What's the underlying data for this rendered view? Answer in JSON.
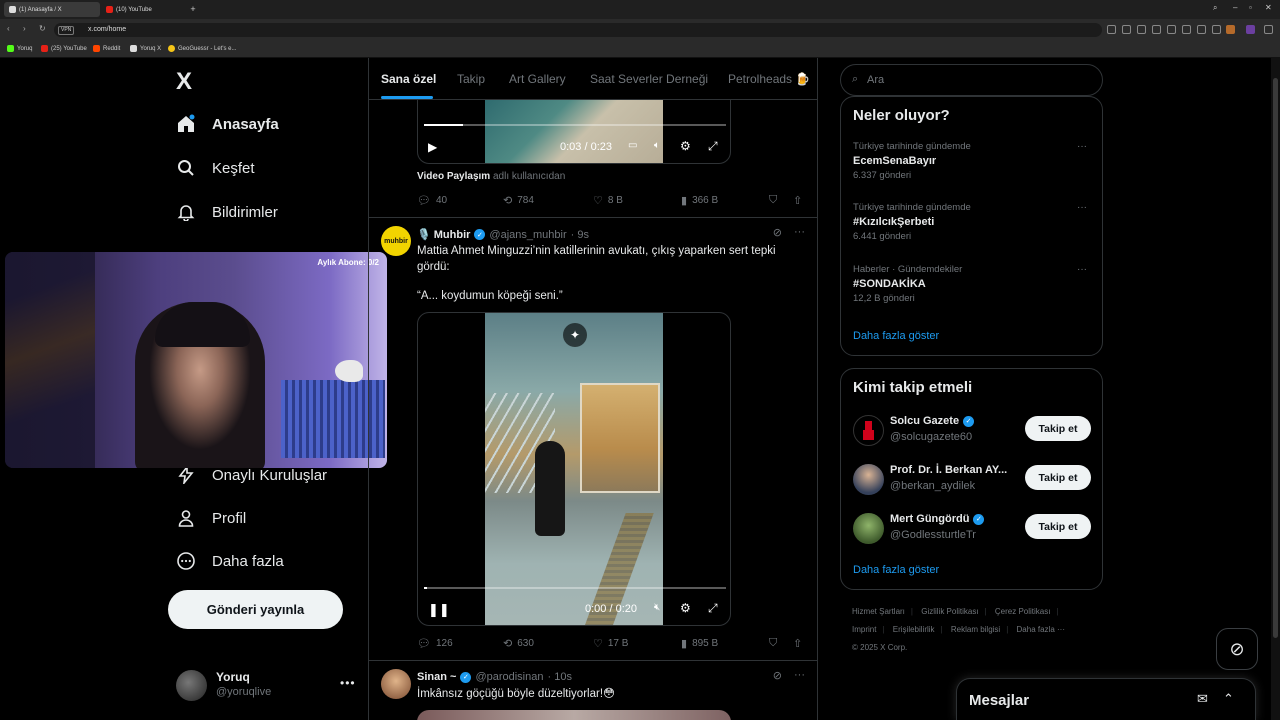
{
  "browser": {
    "tabs": [
      {
        "label": "(1) Anasayfa / X",
        "active": true
      },
      {
        "label": "(10) YouTube",
        "active": false
      }
    ],
    "url": "x.com/home",
    "vpn_label": "VPN",
    "bookmarks": [
      "Yoruq",
      "(25) YouTube",
      "Reddit",
      "Yoruq X",
      "GeoGuessr - Let's e..."
    ]
  },
  "nav": {
    "logo": "X",
    "items": [
      {
        "label": "Anasayfa",
        "icon": "home-icon"
      },
      {
        "label": "Keşfet",
        "icon": "search-icon"
      },
      {
        "label": "Bildirimler",
        "icon": "bell-icon"
      },
      {
        "label": "Onaylı Kuruluşlar",
        "icon": "lightning-icon"
      },
      {
        "label": "Profil",
        "icon": "person-icon"
      },
      {
        "label": "Daha fazla",
        "icon": "more-circle-icon"
      }
    ],
    "post_button": "Gönderi yayınla",
    "account": {
      "name": "Yoruq",
      "handle": "@yoruqlive"
    }
  },
  "webcam": {
    "label": "Aylık Abone: 0/2"
  },
  "feed": {
    "tabs": [
      "Sana özel",
      "Takip",
      "Art Gallery",
      "Saat Severler Derneği",
      "Petrolheads 🍺"
    ],
    "tweet1": {
      "video_time": "0:03 / 0:23",
      "video_progress": 0.13,
      "source_label": "Video Paylaşım",
      "source_suffix": "adlı kullanıcıdan",
      "replies": "40",
      "reposts": "784",
      "likes": "8 B",
      "views": "366 B"
    },
    "tweet2": {
      "avatar_text": "muhbir",
      "name": "🎙️ Muhbir",
      "handle": "@ajans_muhbir",
      "time": "· 9s",
      "text": "Mattia Ahmet Minguzzi’nin katillerinin avukatı, çıkış yaparken sert tepki gördü:",
      "quote": "“A... koydumun köpeği seni.”",
      "video_time": "0:00 / 0:20",
      "video_progress": 0.01,
      "replies": "126",
      "reposts": "630",
      "likes": "17 B",
      "views": "895 B"
    },
    "tweet3": {
      "name": "Sinan ~",
      "handle": "@parodisinan",
      "time": "· 10s",
      "text": "İmkânsız göçüğü böyle düzeltiyorlar!😳"
    }
  },
  "search": {
    "placeholder": "Ara"
  },
  "trends": {
    "title": "Neler oluyor?",
    "items": [
      {
        "context": "Türkiye tarihinde gündemde",
        "name": "EcemSenaBayır",
        "count": "6.337 gönderi"
      },
      {
        "context": "Türkiye tarihinde gündemde",
        "name": "#KızılcıkŞerbeti",
        "count": "6.441 gönderi"
      },
      {
        "context": "Haberler · Gündemdekiler",
        "name": "#SONDAKİKA",
        "count": "12,2 B gönderi"
      }
    ],
    "show_more": "Daha fazla göster"
  },
  "who_to_follow": {
    "title": "Kimi takip etmeli",
    "items": [
      {
        "name": "Solcu Gazete",
        "handle": "@solcugazete60",
        "verified": true,
        "button": "Takip et"
      },
      {
        "name": "Prof. Dr. İ. Berkan AY...",
        "handle": "@berkan_aydilek",
        "verified": false,
        "button": "Takip et"
      },
      {
        "name": "Mert Güngördü",
        "handle": "@GodlessturtleTr",
        "verified": true,
        "button": "Takip et"
      }
    ],
    "show_more": "Daha fazla göster"
  },
  "footer": {
    "links": [
      "Hizmet Şartları",
      "Gizlilik Politikası",
      "Çerez Politikası",
      "Imprint",
      "Erişilebilirlik",
      "Reklam bilgisi",
      "Daha fazla ···"
    ],
    "copyright": "© 2025 X Corp."
  },
  "messages": {
    "title": "Mesajlar"
  },
  "colors": {
    "accent": "#1d9bf0",
    "background": "#000000",
    "text": "#e7e9ea",
    "muted": "#71767b"
  }
}
